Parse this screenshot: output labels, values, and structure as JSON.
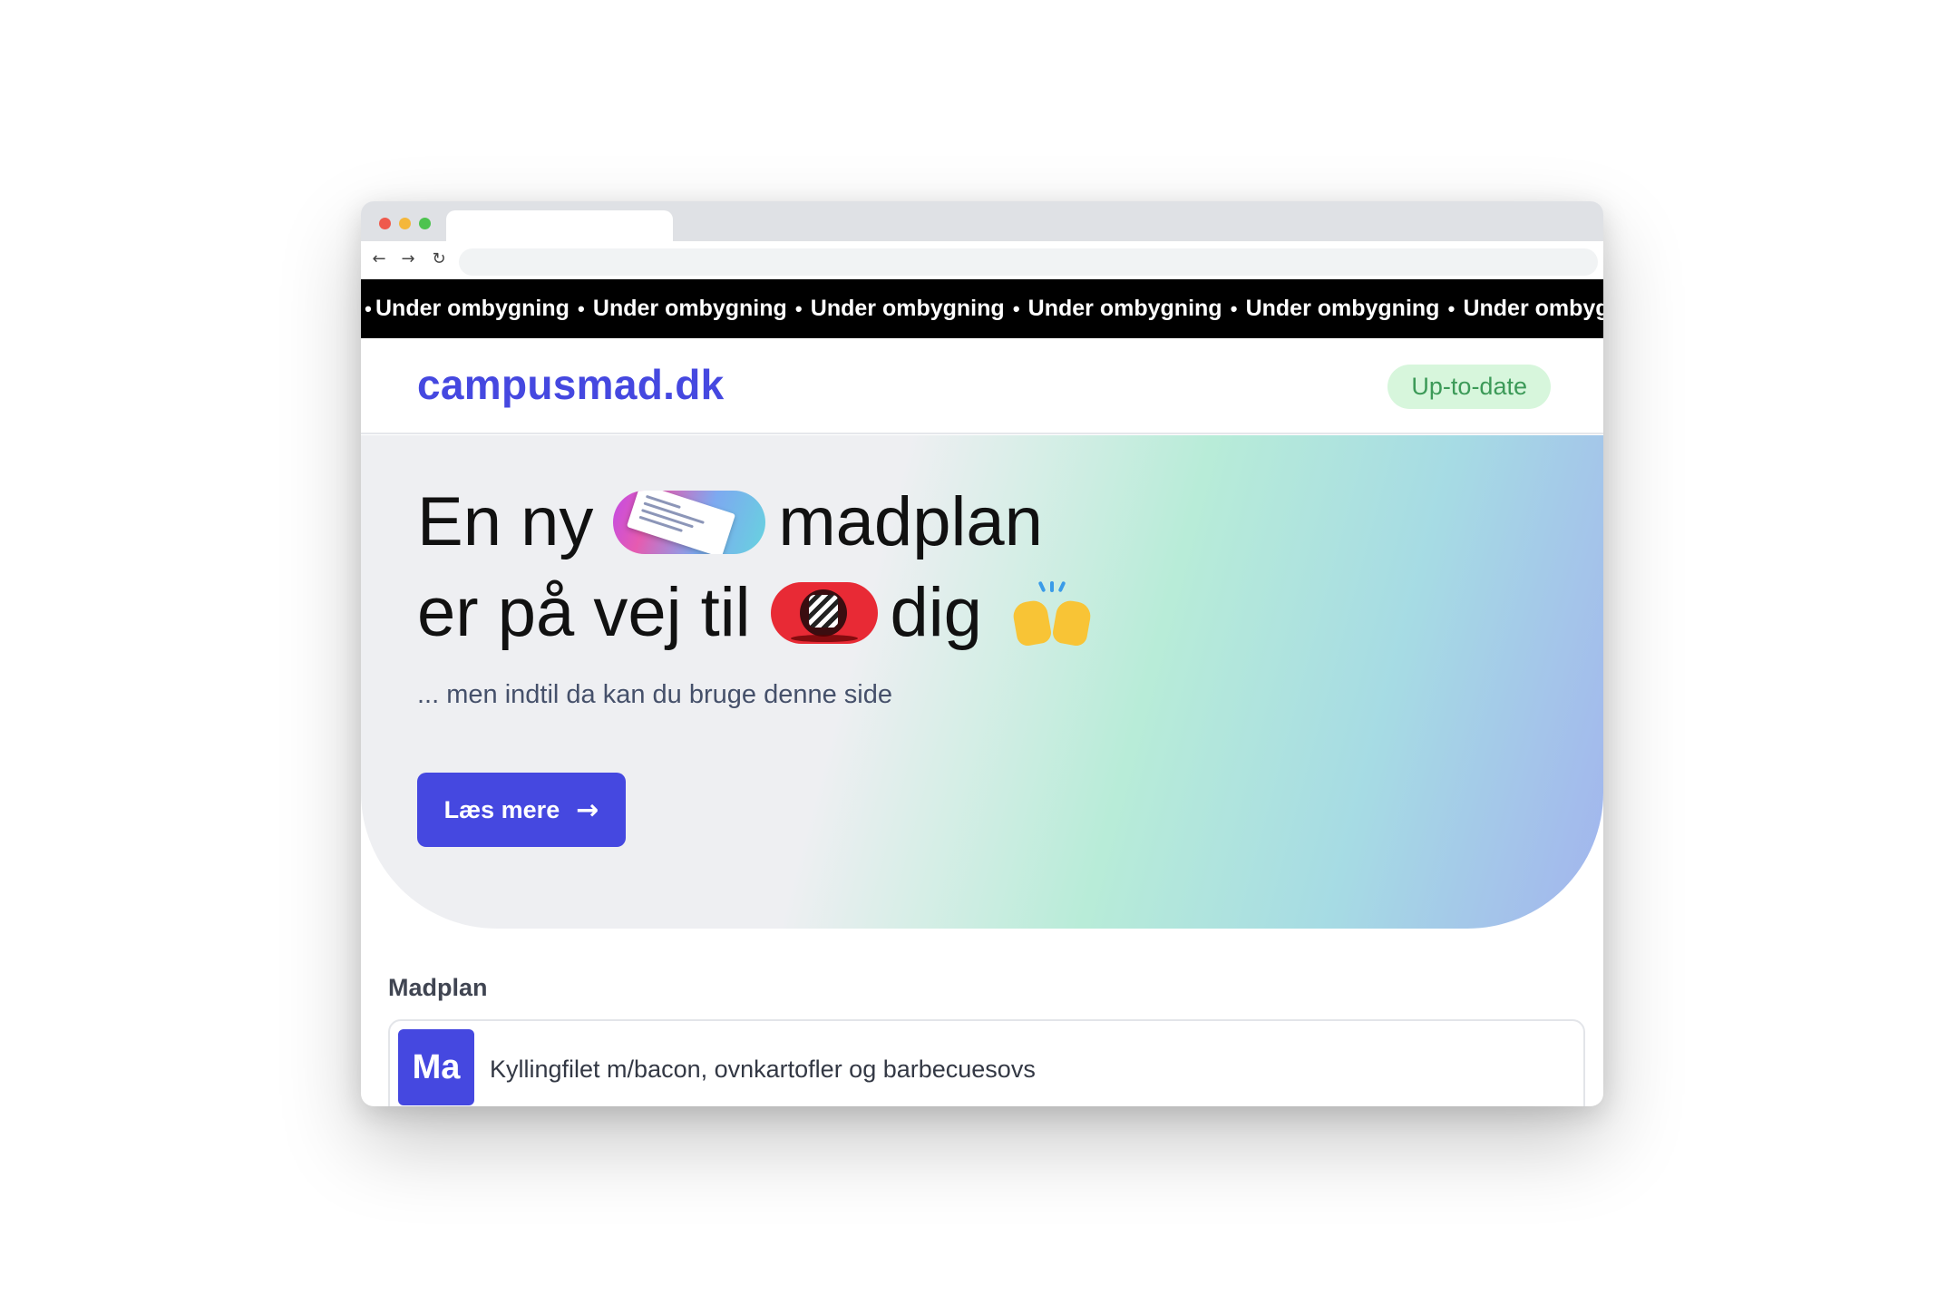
{
  "browser": {
    "nav": {
      "back_icon": "←",
      "forward_icon": "→",
      "reload_icon": "↻"
    }
  },
  "marquee": {
    "items": [
      "Under ombygning",
      "Under ombygning",
      "Under ombygning",
      "Under ombygning",
      "Under ombygning",
      "Under ombygning"
    ],
    "separator": "•"
  },
  "header": {
    "logo": "campusmad.dk",
    "status": "Up-to-date"
  },
  "hero": {
    "line1_part1": "En ny",
    "line1_part2": "madplan",
    "line2_part1": "er på vej til",
    "line2_part2": "dig",
    "subtitle": "... men indtil da kan du bruge denne side",
    "cta_label": "Læs mere",
    "cta_arrow": "→",
    "icons": [
      "meal-plan-pill-icon",
      "running-figure-pill-icon",
      "raising-hands-icon"
    ]
  },
  "menu": {
    "section_title": "Madplan",
    "items": [
      {
        "day": "Ma",
        "dish": "Kyllingfilet m/bacon, ovnkartofler og barbecuesovs"
      }
    ]
  },
  "colors": {
    "brand": "#4548e0",
    "status_bg": "#d7f6dc",
    "status_text": "#3c9a58",
    "marquee_bg": "#000000"
  }
}
